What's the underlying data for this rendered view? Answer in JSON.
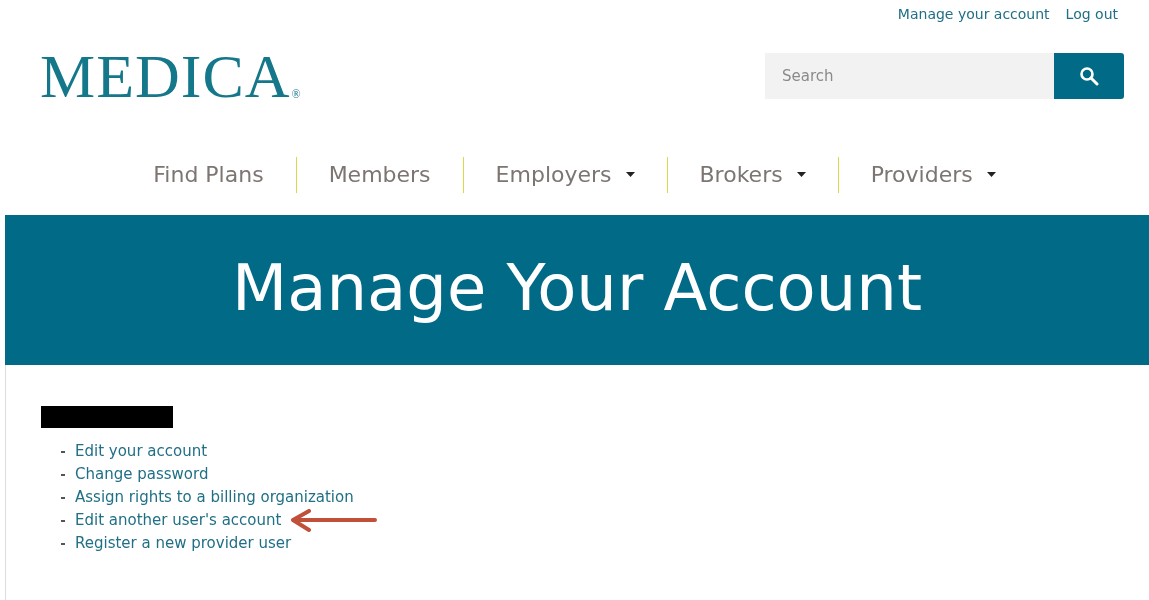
{
  "top_links": [
    "Manage your account",
    "Log out"
  ],
  "logo": {
    "text": "MEDICA",
    "mark": "®"
  },
  "search": {
    "placeholder": "Search"
  },
  "nav": [
    {
      "label": "Find Plans",
      "dropdown": false
    },
    {
      "label": "Members",
      "dropdown": false
    },
    {
      "label": "Employers",
      "dropdown": true
    },
    {
      "label": "Brokers",
      "dropdown": true
    },
    {
      "label": "Providers",
      "dropdown": true
    }
  ],
  "banner": {
    "title": "Manage Your Account"
  },
  "links": [
    {
      "label": "Edit your account",
      "annotated": false
    },
    {
      "label": "Change password",
      "annotated": false
    },
    {
      "label": "Assign rights to a billing organization",
      "annotated": false
    },
    {
      "label": "Edit another user's account",
      "annotated": true
    },
    {
      "label": "Register a new provider user",
      "annotated": false
    }
  ]
}
